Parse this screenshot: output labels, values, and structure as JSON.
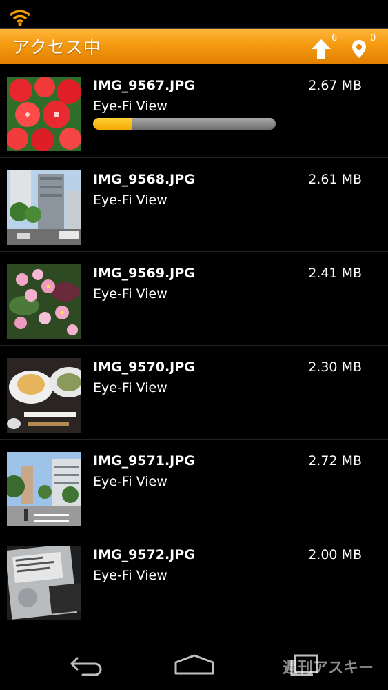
{
  "status_bar": {
    "wifi_icon": "wifi-icon",
    "wifi_color": "#f5a000"
  },
  "action_bar": {
    "title": "アクセス中",
    "upload_icon": "upload-arrow-icon",
    "upload_count": "6",
    "location_icon": "location-pin-icon",
    "location_count": "0",
    "gradient_colors": [
      "#ffb43a",
      "#e27f00"
    ]
  },
  "files": [
    {
      "name": "IMG_9567.JPG",
      "size": "2.67 MB",
      "subtitle": "Eye-Fi View",
      "thumbnail": "red-flowers-photo",
      "progress": 0.21
    },
    {
      "name": "IMG_9568.JPG",
      "size": "2.61 MB",
      "subtitle": "Eye-Fi View",
      "thumbnail": "city-buildings-photo"
    },
    {
      "name": "IMG_9569.JPG",
      "size": "2.41 MB",
      "subtitle": "Eye-Fi View",
      "thumbnail": "pink-flowers-photo"
    },
    {
      "name": "IMG_9570.JPG",
      "size": "2.30 MB",
      "subtitle": "Eye-Fi View",
      "thumbnail": "food-dishes-photo"
    },
    {
      "name": "IMG_9571.JPG",
      "size": "2.72 MB",
      "subtitle": "Eye-Fi View",
      "thumbnail": "street-view-photo"
    },
    {
      "name": "IMG_9572.JPG",
      "size": "2.00 MB",
      "subtitle": "Eye-Fi View",
      "thumbnail": "hard-drive-photo"
    }
  ],
  "nav_bar": {
    "back_icon": "back-icon",
    "home_icon": "home-icon",
    "recents_icon": "recent-apps-icon"
  },
  "watermark": "週刊アスキー"
}
